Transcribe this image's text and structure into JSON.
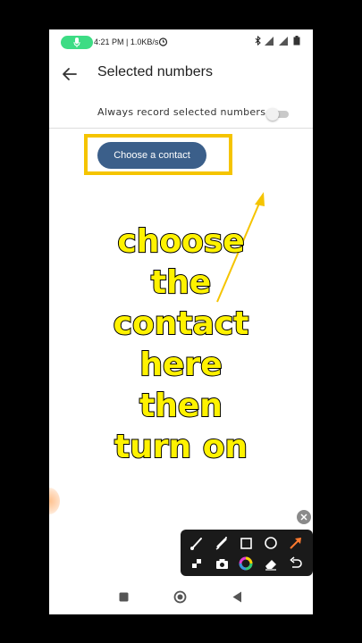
{
  "status_bar": {
    "time_speed": "4:21 PM | 1.0KB/s",
    "icons": [
      "mic-icon",
      "alarm-icon",
      "bluetooth-icon",
      "signal-icon",
      "battery-icon"
    ]
  },
  "app_bar": {
    "title": "Selected numbers",
    "back_icon": "arrow-left-icon"
  },
  "settings": {
    "always_record_label": "Always record selected numbers",
    "always_record_enabled": false
  },
  "contact_button": {
    "label": "Choose a contact"
  },
  "annotation": {
    "lines": [
      "choose",
      "the",
      "contact",
      "here",
      "then",
      "turn on"
    ],
    "text_color": "#fff200",
    "box_color": "#f5c400"
  },
  "draw_toolbar": {
    "tools": [
      "brush-icon",
      "highlighter-icon",
      "square-icon",
      "circle-icon",
      "arrow-icon",
      "mosaic-icon",
      "camera-icon",
      "color-wheel-icon",
      "eraser-icon",
      "undo-icon"
    ]
  },
  "colors": {
    "button_bg": "#3b5f8a",
    "mic_pill": "#3ddc84"
  }
}
